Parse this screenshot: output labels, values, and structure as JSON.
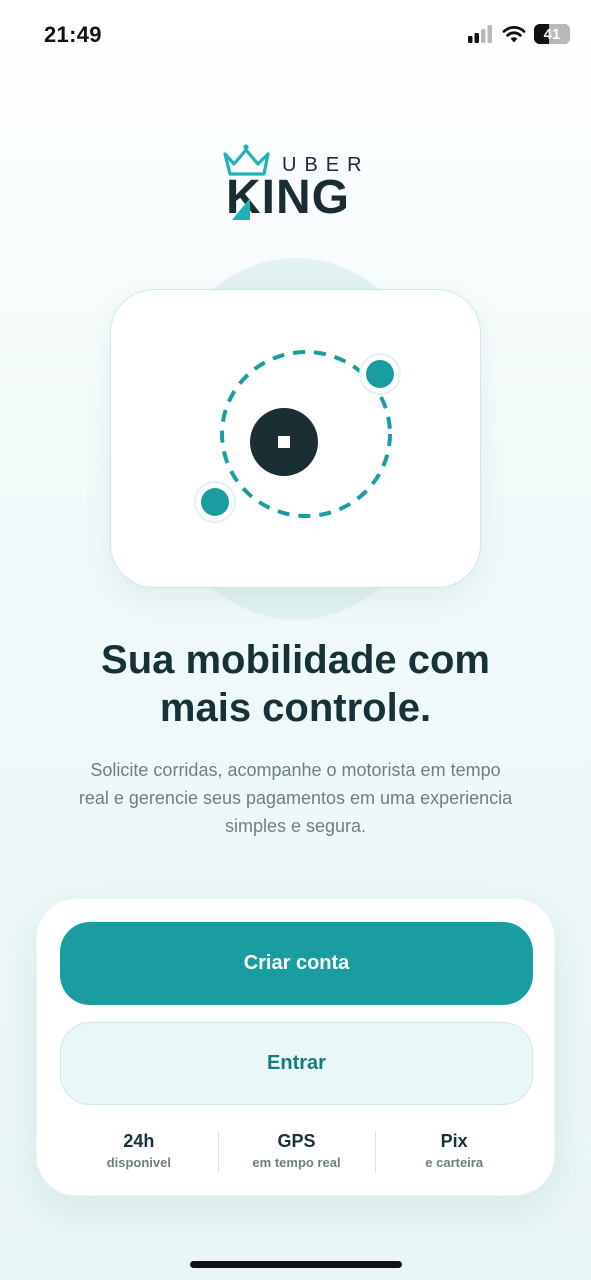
{
  "status_bar": {
    "time": "21:49",
    "battery_level": "41",
    "icons": [
      "signal-icon",
      "wifi-icon",
      "battery-icon"
    ]
  },
  "logo": {
    "brand_top": "UBER",
    "brand_bottom": "KING",
    "icon": "crown-icon"
  },
  "hero": {
    "icons": [
      "orbit-illustration",
      "center-stop-icon",
      "orbit-dot-icon"
    ]
  },
  "headline": {
    "line1": "Sua mobilidade com",
    "line2": "mais controle."
  },
  "subtitle": {
    "line1": "Solicite corridas, acompanhe o motorista em tempo",
    "line2": "real e gerencie seus pagamentos em uma experiencia",
    "line3": "simples e segura."
  },
  "actions": {
    "primary_label": "Criar conta",
    "secondary_label": "Entrar"
  },
  "stats": [
    {
      "value": "24h",
      "label": "disponivel"
    },
    {
      "value": "GPS",
      "label": "em tempo real"
    },
    {
      "value": "Pix",
      "label": "e carteira"
    }
  ],
  "colors": {
    "accent": "#1a9da1",
    "dark": "#163237",
    "muted": "#6e7e82",
    "soft_bg": "#eaf7f7"
  }
}
